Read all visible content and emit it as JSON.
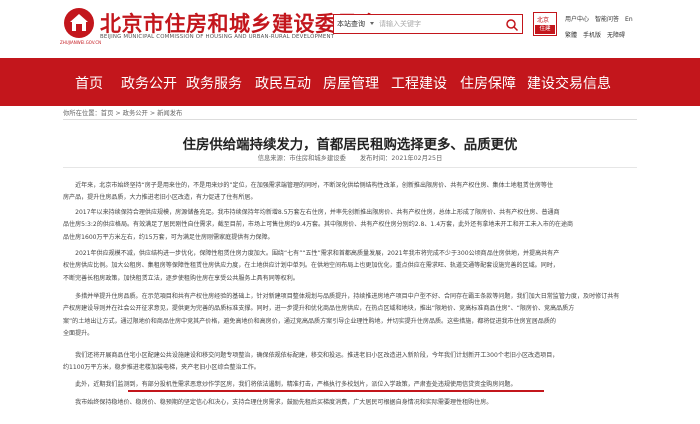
{
  "header": {
    "site_title": "北京市住房和城乡建设委员会",
    "site_subtitle": "BEIJING MUNICIPAL COMMISSION OF HOUSING AND URBAN-RURAL DEVELOPMENT",
    "logo_sub": "ZHUJIANWEI.GOV.CN",
    "search_scope": "本站查询",
    "search_placeholder": "请输入关键字",
    "badge_top": "北京",
    "badge_bottom": "住建",
    "tools_row1": [
      "用户中心",
      "智能问答",
      "En"
    ],
    "tools_row2": [
      "繁體",
      "手机版",
      "无障碍"
    ]
  },
  "nav": {
    "items": [
      "首页",
      "政务公开",
      "政务服务",
      "政民互动",
      "房屋管理",
      "工程建设",
      "住房保障",
      "建设交易信息"
    ]
  },
  "breadcrumb": {
    "prefix": "你所在位置：",
    "items": [
      "首页",
      "政务公开",
      "新闻发布"
    ],
    "separator": ">"
  },
  "article": {
    "title": "住房供给端持续发力，首都居民租购选择更多、品质更优",
    "source_label": "信息来源：",
    "source": "市住房和城乡建设委",
    "date_label": "发布时间：",
    "date": "2021年02月25日",
    "paragraphs": [
      [
        "　　近年来，北京市始终坚持“房子是用来住的，不是用来炒的”定位，在加强需求端管理的同时，不断深化供给侧结构性改革，创新推出限房价、共有产权住房、集体土地租赁住房等住",
        "房产品，提升住房品质，大力推进老旧小区改造，有力促进了住有所居。"
      ],
      [
        "　　2017年以来持续保持合理供应规模，房源储备充足。我市持续保持年均新增8.5万套左右住房，并率先创新推出限房价、共有产权住房，总体上形成了限房价、共有产权住房、普通商",
        "品住房5:3:2的供应格局。有效满足了居民刚性自住需求，截至目前，市场上可售住房约9.4万套。其中限房价、共有产权住房分别约2.8、1.4万套，此外还有拿地未开工和开工未入市的在途商",
        "品住房1600万平方米左右，约15万套，可为满足住房刚需家庭提供有力保障。"
      ],
      [
        "　　2021年供应规模不减，供应结构进一步优化，保障性租赁住房力度加大。围绕“七有”“五性”需求和首都高质量发展，2021年我市将完成不少于300公顷商品住房供地，并提高共有产",
        "权住房供应比例。加大公租房、集租房等保障性租赁住房供应力度，在土地供应计划中单列。在供地空间布局上也更加优化，重点供应在需求旺、轨道交通等配套设施完善的区域。同时，",
        "不断完善长租房政策，加快租赁立法，逐步使租购住房在享受公共服务上具有同等权利。"
      ],
      [
        "　　多措并举提升住房品质。在示范項目和共有产权住房经验的基础上，针对新建项目整体规划与品质提升，持续推进房地产项目中户型不好、合同存在霸王条款等问题，我们加大日常监管力度，及时修订共有",
        "产权房建设导则并在社会公开征求意见，提供更为完善的品质标准支撑。同时，进一步提升和优化商品住房供应，在热点区域和地块，推出“限地价、竞高标准商品住房”、“限房价、竞高品质方",
        "案”的土地出让方式，通过限地价和商品住房中竞其产价格，避免高地价和高房价，通过竞高品质方案引导企业理性购地，并切实提升住房品质。这些措施，都将促进我市住房宜居品质的",
        "全面提升。"
      ],
      [
        "　　我们还将开展商品住宅小区配建公共设施建设和移交问题专项整治，确保依规依标配建，移交和投运。推进老旧小区改造进入新阶段，今年我们计划新开工300个老旧小区改造项目，",
        "约1100万平方米，稳步推进老楼加装电梯，夹产老旧小区综合整治工作。"
      ],
      [
        "　　此外，近期我们监测到，有部分投机性需求恶意炒作学区房，我们将依法遏制，精准打击，严格执行多校划片，派位入学政策，严肃查处违规使用信贷资金购房问题。"
      ],
      [
        "　　我市始终保持稳地价、稳房价、稳预期的坚定信心和决心，支持合理住房需求，鼓励先租后买梯度消费，广大居民可根据自身情况和实际需要理性租购住房。"
      ]
    ]
  },
  "colors": {
    "brand_red": "#c3161c",
    "nav_bg": "#c3161c"
  }
}
